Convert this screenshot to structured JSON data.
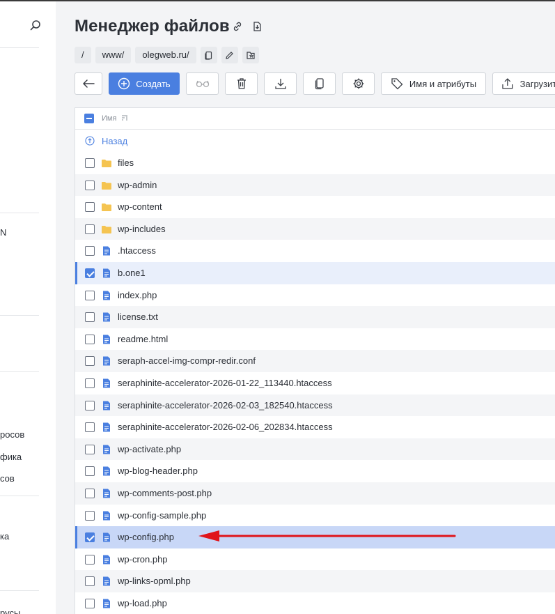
{
  "sidebar": {
    "partial_labels": [
      "N",
      "росов",
      "фика",
      "сов",
      "ка",
      "русы"
    ]
  },
  "header": {
    "title": "Менеджер файлов",
    "link_icon": "link-icon",
    "download_icon": "download-icon"
  },
  "breadcrumbs": {
    "items": [
      "/",
      "www/",
      "olegweb.ru/"
    ],
    "actions": [
      "copy-icon",
      "edit-icon",
      "bookmark-icon"
    ]
  },
  "toolbar": {
    "back_icon": "arrow-left-icon",
    "create_label": "Создать",
    "view_icon": "glasses-icon",
    "delete_icon": "trash-icon",
    "download_icon": "download-icon",
    "copy_icon": "copy-icon",
    "settings_icon": "gear-icon",
    "attributes_label": "Имя и атрибуты",
    "upload_label": "Загрузить"
  },
  "table": {
    "header_name": "Имя",
    "back_label": "Назад",
    "rows": [
      {
        "name": "files",
        "type": "folder",
        "checked": false
      },
      {
        "name": "wp-admin",
        "type": "folder",
        "checked": false
      },
      {
        "name": "wp-content",
        "type": "folder",
        "checked": false
      },
      {
        "name": "wp-includes",
        "type": "folder",
        "checked": false
      },
      {
        "name": ".htaccess",
        "type": "file",
        "checked": false
      },
      {
        "name": "b.one1",
        "type": "file",
        "checked": true
      },
      {
        "name": "index.php",
        "type": "file",
        "checked": false
      },
      {
        "name": "license.txt",
        "type": "file",
        "checked": false
      },
      {
        "name": "readme.html",
        "type": "file",
        "checked": false
      },
      {
        "name": "seraph-accel-img-compr-redir.conf",
        "type": "file",
        "checked": false
      },
      {
        "name": "seraphinite-accelerator-2026-01-22_113440.htaccess",
        "type": "file",
        "checked": false
      },
      {
        "name": "seraphinite-accelerator-2026-02-03_182540.htaccess",
        "type": "file",
        "checked": false
      },
      {
        "name": "seraphinite-accelerator-2026-02-06_202834.htaccess",
        "type": "file",
        "checked": false
      },
      {
        "name": "wp-activate.php",
        "type": "file",
        "checked": false
      },
      {
        "name": "wp-blog-header.php",
        "type": "file",
        "checked": false
      },
      {
        "name": "wp-comments-post.php",
        "type": "file",
        "checked": false
      },
      {
        "name": "wp-config-sample.php",
        "type": "file",
        "checked": false
      },
      {
        "name": "wp-config.php",
        "type": "file",
        "checked": true,
        "highlight": true
      },
      {
        "name": "wp-cron.php",
        "type": "file",
        "checked": false
      },
      {
        "name": "wp-links-opml.php",
        "type": "file",
        "checked": false
      },
      {
        "name": "wp-load.php",
        "type": "file",
        "checked": false
      }
    ]
  },
  "colors": {
    "accent": "#4a7fe0",
    "folder": "#f5c451",
    "file": "#4a7fe0",
    "arrow": "#e0151b"
  }
}
